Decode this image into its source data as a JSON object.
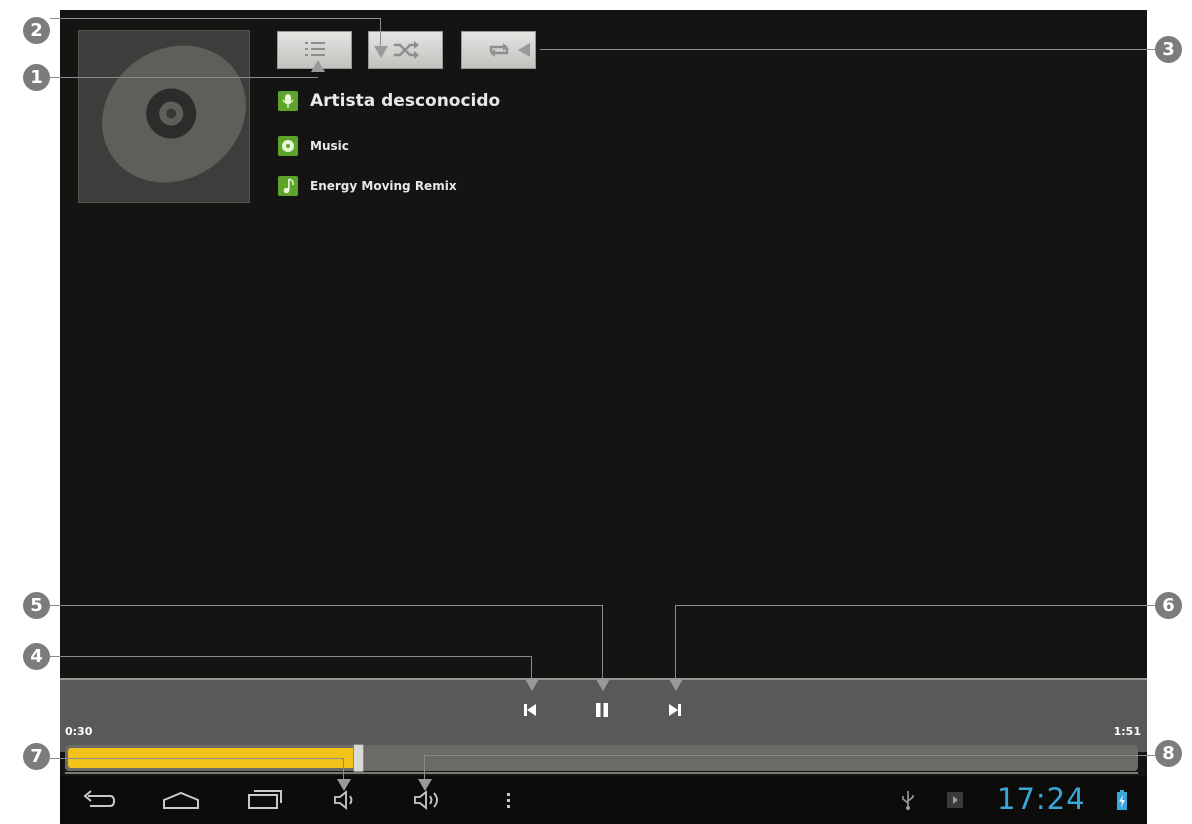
{
  "now_playing": {
    "artist": "Artista desconocido",
    "album": "Music",
    "title": "Energy Moving Remix"
  },
  "toolbar": {
    "playlist_icon": "list-icon",
    "shuffle_icon": "shuffle-icon",
    "repeat_icon": "repeat-icon"
  },
  "playback": {
    "elapsed": "0:30",
    "duration": "1:51",
    "progress_fraction": 0.27,
    "state": "playing"
  },
  "status_bar": {
    "clock": "17:24"
  },
  "callouts": [
    "1",
    "2",
    "3",
    "4",
    "5",
    "6",
    "7",
    "8"
  ],
  "colors": {
    "seek_fill": "#f2c31a",
    "meta_icon": "#5fa42a",
    "clock": "#3aa7d9",
    "background": "#141412"
  }
}
